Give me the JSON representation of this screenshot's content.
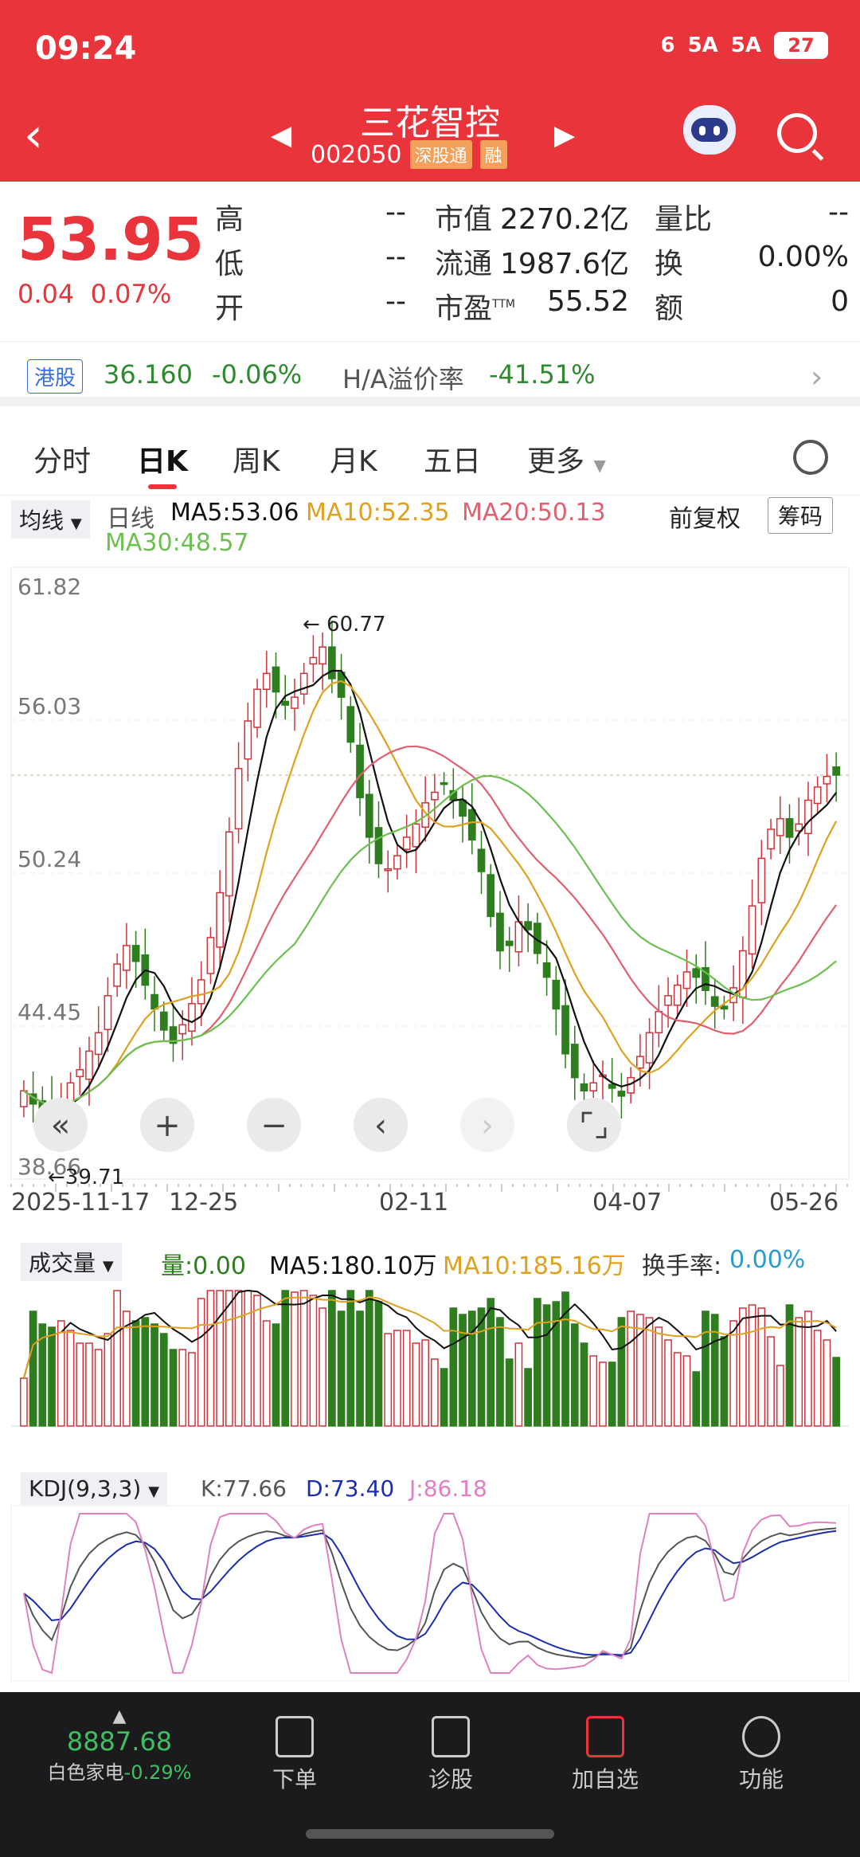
{
  "status": {
    "time": "09:24",
    "net1": "6",
    "net2": "5A",
    "net3": "5A",
    "battery": "27"
  },
  "header": {
    "name": "三花智控",
    "code": "002050",
    "tag1": "深股通",
    "tag2": "融"
  },
  "quote": {
    "price": "53.95",
    "change": "0.04",
    "change_pct": "0.07%",
    "high_label": "高",
    "high_val": "--",
    "low_label": "低",
    "low_val": "--",
    "open_label": "开",
    "open_val": "--",
    "mcap_label": "市值",
    "mcap_val": "2270.2亿",
    "float_label": "流通",
    "float_val": "1987.6亿",
    "pe_label": "市盈",
    "pe_sup": "TTM",
    "pe_val": "55.52",
    "vr_label": "量比",
    "vr_val": "--",
    "turn_label": "换",
    "turn_val": "0.00%",
    "amt_label": "额",
    "amt_val": "0"
  },
  "hk": {
    "tag": "港股",
    "price": "36.160",
    "pct": "-0.06%",
    "premium_label": "H/A溢价率",
    "premium": "-41.51%"
  },
  "tabs": [
    "分时",
    "日K",
    "周K",
    "月K",
    "五日",
    "更多"
  ],
  "ma": {
    "dropdown": "均线",
    "period": "日线",
    "ma5": "MA5:53.06",
    "ma10": "MA10:52.35",
    "ma20": "MA20:50.13",
    "ma30": "MA30:48.57",
    "fq": "前复权",
    "chip": "筹码"
  },
  "chart_data": {
    "type": "candlestick",
    "y_ticks": [
      "61.82",
      "56.03",
      "50.24",
      "44.45",
      "38.66"
    ],
    "ylim": [
      38.66,
      61.82
    ],
    "max_label": "60.77",
    "min_label": "39.71",
    "x_ticks": [
      "2025-11-17",
      "12-25",
      "02-11",
      "04-07",
      "05-26"
    ],
    "last_price": 53.95,
    "close": [
      42.0,
      41.5,
      41.2,
      40.8,
      41.6,
      42.3,
      42.8,
      43.5,
      44.2,
      45.6,
      46.8,
      47.5,
      46.9,
      46.0,
      45.1,
      44.3,
      43.8,
      44.5,
      45.3,
      46.2,
      47.8,
      49.5,
      51.8,
      54.2,
      56.0,
      57.2,
      57.8,
      57.1,
      56.6,
      56.9,
      57.8,
      58.4,
      58.8,
      57.6,
      56.9,
      55.2,
      53.1,
      51.6,
      50.6,
      50.4,
      50.9,
      51.6,
      52.1,
      52.9,
      53.3,
      53.6,
      53.0,
      52.4,
      51.5,
      50.3,
      48.6,
      47.3,
      47.5,
      48.4,
      48.1,
      47.2,
      46.3,
      45.1,
      43.4,
      42.5,
      42.0,
      42.3,
      42.6,
      42.1,
      41.8,
      42.5,
      43.3,
      44.2,
      45.0,
      45.6,
      46.0,
      46.5,
      46.3,
      45.8,
      45.2,
      45.1,
      45.9,
      47.3,
      49.0,
      50.8,
      51.9,
      52.3,
      51.6,
      52.1,
      53.0,
      53.5,
      53.9,
      53.95
    ],
    "volume_header": {
      "dropdown": "成交量",
      "vol": "量:0.00",
      "ma5": "MA5:180.10万",
      "ma10": "MA10:185.16万",
      "turn_label": "换手率:",
      "turn_val": "0.00%"
    },
    "kdj_header": {
      "dropdown": "KDJ(9,3,3)",
      "k": "K:77.66",
      "d": "D:73.40",
      "j": "J:86.18"
    },
    "colors": {
      "up": "#d0343a",
      "down": "#2e7d1e",
      "ma5": "#111111",
      "ma10": "#e0a020",
      "ma20": "#e06070",
      "ma30": "#6cc050",
      "k": "#555555",
      "d": "#1a2eb0",
      "j": "#e080c0"
    }
  },
  "bottom": {
    "index_val": "8887.68",
    "index_name": "白色家电",
    "index_pct": "-0.29%",
    "items": [
      "下单",
      "诊股",
      "加自选",
      "功能"
    ]
  }
}
